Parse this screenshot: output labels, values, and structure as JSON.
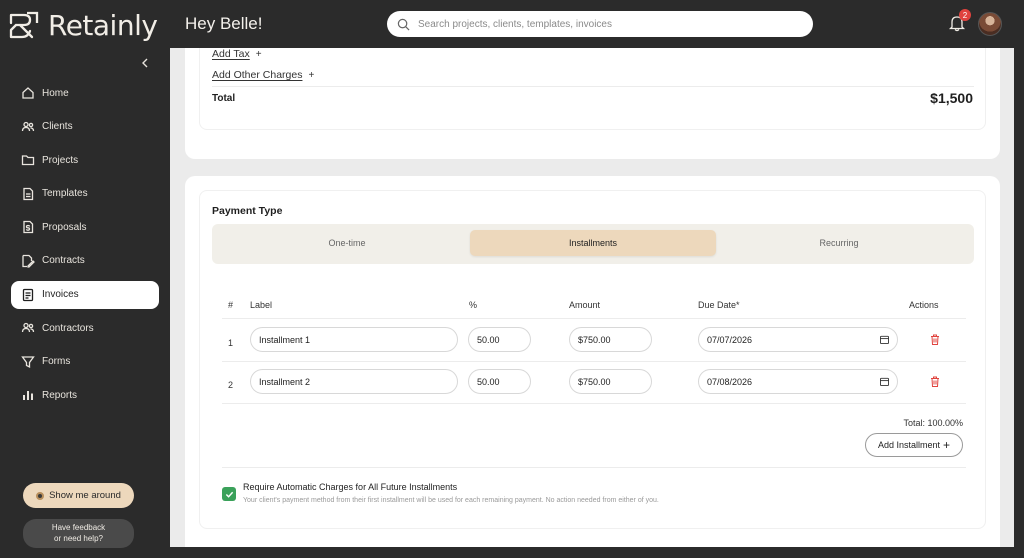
{
  "app": {
    "name": "Retainly"
  },
  "header": {
    "greeting": "Hey Belle!",
    "search_placeholder": "Search projects, clients, templates, invoices",
    "notification_count": "2"
  },
  "sidebar": {
    "items": [
      {
        "label": "Home",
        "icon": "home-icon"
      },
      {
        "label": "Clients",
        "icon": "users-icon"
      },
      {
        "label": "Projects",
        "icon": "folder-icon"
      },
      {
        "label": "Templates",
        "icon": "file-icon"
      },
      {
        "label": "Proposals",
        "icon": "file-dollar-icon"
      },
      {
        "label": "Contracts",
        "icon": "contract-icon"
      },
      {
        "label": "Invoices",
        "icon": "invoice-icon",
        "active": true
      },
      {
        "label": "Contractors",
        "icon": "users-icon"
      },
      {
        "label": "Forms",
        "icon": "funnel-icon"
      },
      {
        "label": "Reports",
        "icon": "bar-chart-icon"
      }
    ],
    "tour_label": "Show me around",
    "help_line1": "Have feedback",
    "help_line2": "or need help?"
  },
  "summary": {
    "add_tax": "Add Tax",
    "add_other_charges": "Add Other Charges",
    "plus": "+",
    "total_label": "Total",
    "total_value": "$1,500"
  },
  "payment": {
    "title": "Payment Type",
    "options": [
      "One-time",
      "Installments",
      "Recurring"
    ],
    "selected": "Installments",
    "columns": [
      "#",
      "Label",
      "%",
      "Amount",
      "Due Date*",
      "Actions"
    ],
    "installments": [
      {
        "num": "1",
        "label": "Installment 1",
        "percent": "50.00",
        "amount": "$750.00",
        "due": "07/07/2026"
      },
      {
        "num": "2",
        "label": "Installment 2",
        "percent": "50.00",
        "amount": "$750.00",
        "due": "07/08/2026"
      }
    ],
    "total_percent": "Total: 100.00%",
    "add_installment": "Add Installment",
    "add_plus": "+",
    "auto_charge_label": "Require Automatic Charges for All Future Installments",
    "auto_charge_note": "Your client's payment method from their first installment will be used for each remaining payment. No action needed from either of you.",
    "auto_charge_checked": true
  },
  "colors": {
    "accent": "#edd8bc",
    "dark": "#2b2b2b",
    "check": "#3aa15a",
    "danger": "#e0433e"
  }
}
